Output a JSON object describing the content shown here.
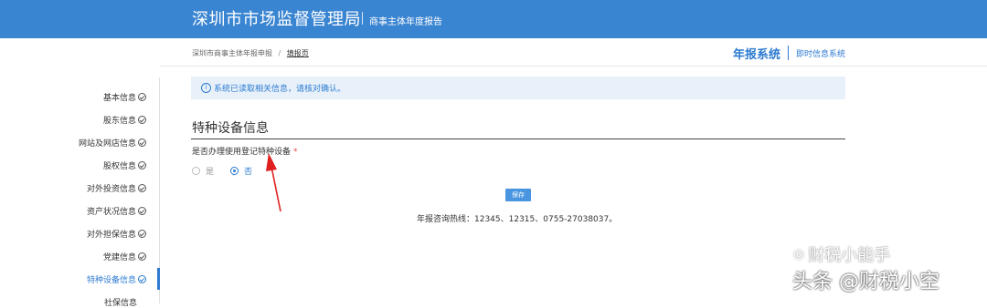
{
  "header": {
    "title": "深圳市市场监督管理局",
    "subtitle": "商事主体年度报告"
  },
  "breadcrumb": {
    "parent": "深圳市商事主体年报申报",
    "separator": "/",
    "current": "填报页"
  },
  "systems": {
    "current": "年报系统",
    "other": "即时信息系统"
  },
  "sidebar": {
    "items": [
      {
        "label": "基本信息"
      },
      {
        "label": "股东信息"
      },
      {
        "label": "网站及网店信息"
      },
      {
        "label": "股权信息"
      },
      {
        "label": "对外投资信息"
      },
      {
        "label": "资产状况信息"
      },
      {
        "label": "对外担保信息"
      },
      {
        "label": "党建信息"
      },
      {
        "label": "特种设备信息"
      },
      {
        "label": "社保信息"
      }
    ],
    "active_index": 8
  },
  "alert": {
    "icon": "info-icon",
    "text": "系统已读取相关信息，请核对确认。"
  },
  "section": {
    "title": "特种设备信息",
    "field_label": "是否办理使用登记特种设备",
    "required_mark": "*",
    "options": [
      {
        "label": "是",
        "checked": false
      },
      {
        "label": "否",
        "checked": true
      }
    ]
  },
  "actions": {
    "save_label": "保存"
  },
  "footer": {
    "hotline": "年报咨询热线：12345、12315、0755-27038037。"
  },
  "watermarks": {
    "line1": "财税小能手",
    "line2": "头条 @财税小空"
  },
  "colors": {
    "brand_blue": "#3a85d1",
    "accent": "#2d7bd0",
    "required": "#e94b4b",
    "annotation_arrow": "#e02020"
  }
}
